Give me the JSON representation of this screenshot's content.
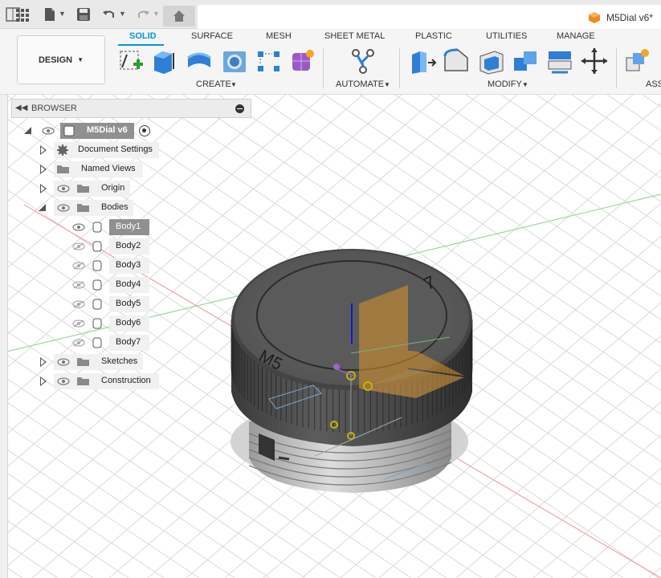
{
  "app": {
    "document_title": "M5Dial v6*",
    "accent_color": "#0696d7"
  },
  "titlebar": {
    "icons": [
      "apps-grid-icon",
      "file-icon",
      "save-icon",
      "undo-icon",
      "redo-icon",
      "home-icon"
    ]
  },
  "workspace": {
    "label": "DESIGN"
  },
  "ribbon": {
    "tabs": [
      {
        "label": "SOLID",
        "active": true
      },
      {
        "label": "SURFACE",
        "active": false
      },
      {
        "label": "MESH",
        "active": false
      },
      {
        "label": "SHEET METAL",
        "active": false
      },
      {
        "label": "PLASTIC",
        "active": false
      },
      {
        "label": "UTILITIES",
        "active": false
      },
      {
        "label": "MANAGE",
        "active": false
      }
    ],
    "groups": [
      {
        "label": "CREATE",
        "tools": [
          "create-sketch-icon",
          "extrude-icon",
          "revolve-icon",
          "hole-icon",
          "pattern-icon",
          "form-icon"
        ]
      },
      {
        "label": "AUTOMATE",
        "tools": [
          "automate-icon"
        ]
      },
      {
        "label": "MODIFY",
        "tools": [
          "press-pull-icon",
          "fillet-icon",
          "shell-icon",
          "combine-icon",
          "replace-face-icon",
          "move-icon"
        ]
      },
      {
        "label": "ASS",
        "tools": [
          "new-component-icon"
        ]
      }
    ]
  },
  "browser": {
    "title": "BROWSER",
    "root": {
      "label": "M5Dial v6"
    },
    "items": [
      {
        "label": "Document Settings",
        "icon": "gear-icon"
      },
      {
        "label": "Named Views",
        "icon": "folder-icon"
      },
      {
        "label": "Origin",
        "icon": "folder-icon"
      },
      {
        "label": "Bodies",
        "icon": "folder-icon"
      },
      {
        "label": "Sketches",
        "icon": "folder-icon"
      },
      {
        "label": "Construction",
        "icon": "folder-icon"
      }
    ],
    "bodies": [
      {
        "label": "Body1",
        "visible": true,
        "selected": true
      },
      {
        "label": "Body2",
        "visible": false,
        "selected": false
      },
      {
        "label": "Body3",
        "visible": false,
        "selected": false
      },
      {
        "label": "Body4",
        "visible": false,
        "selected": false
      },
      {
        "label": "Body5",
        "visible": false,
        "selected": false
      },
      {
        "label": "Body6",
        "visible": false,
        "selected": false
      },
      {
        "label": "Body7",
        "visible": false,
        "selected": false
      }
    ]
  },
  "model": {
    "engraving": "M5",
    "tick_mark": "7"
  }
}
